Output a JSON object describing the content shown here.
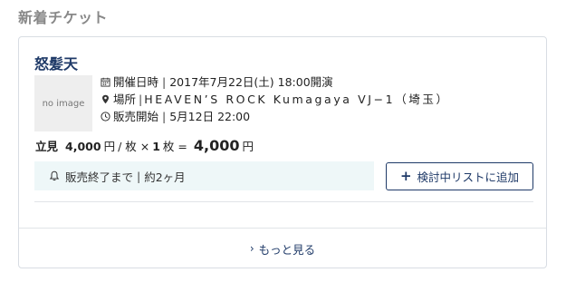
{
  "section": {
    "title": "新着チケット"
  },
  "event": {
    "title": "怒髪天",
    "thumbnail_text": "no image",
    "date_label": "開催日時",
    "date_value": "2017年7月22日(土) 18:00開演",
    "venue_label": "場所",
    "venue_value": "HEAVEN’S ROCK Kumagaya VJ−1（埼玉）",
    "sale_label": "販売開始",
    "sale_value": "5月12日 22:00"
  },
  "price": {
    "seat_type": "立見",
    "unit_price": "4,000",
    "yen": "円",
    "per": "/ 枚 ×",
    "quantity": "1",
    "qty_unit": "枚 =",
    "total": "4,000",
    "total_yen": "円"
  },
  "notice": {
    "label": "販売終了まで",
    "value": "約2ヶ月"
  },
  "wishlist_button": {
    "label": "検討中リストに追加"
  },
  "more_link": {
    "label": "もっと見る"
  },
  "colors": {
    "accent": "#1f3a68",
    "notice_bg": "#eef7f8",
    "border": "#d8dde3"
  },
  "icons": {
    "date": "calendar-icon",
    "venue": "map-pin-icon",
    "sale": "clock-icon",
    "notice": "bell-icon",
    "wishlist": "plus-icon",
    "more": "chevron-right-icon"
  }
}
